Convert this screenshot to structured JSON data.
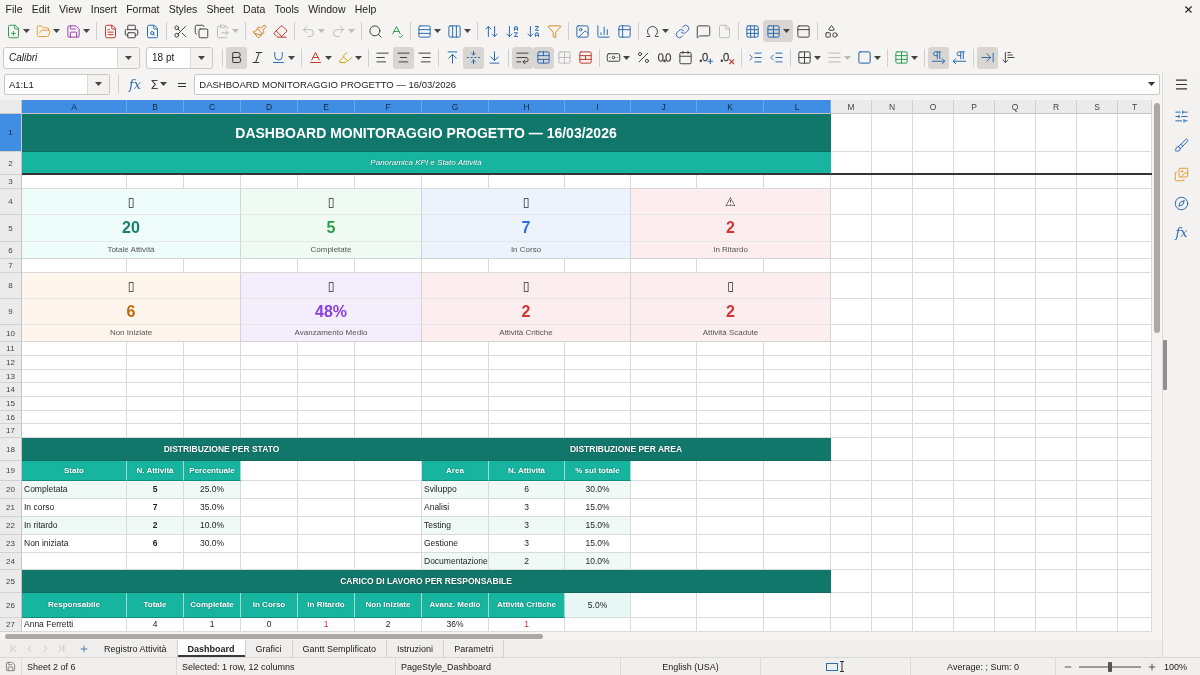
{
  "menu_bar": {
    "items": [
      "File",
      "Edit",
      "View",
      "Insert",
      "Format",
      "Styles",
      "Sheet",
      "Data",
      "Tools",
      "Window",
      "Help"
    ]
  },
  "standard_toolbar": {
    "buttons": [
      {
        "pressed": false,
        "disabled": false
      },
      {
        "pressed": false,
        "disabled": false
      },
      {
        "pressed": false,
        "disabled": false
      },
      {
        "pressed": false,
        "disabled": false
      },
      {
        "pressed": false,
        "disabled": false
      },
      {
        "pressed": false,
        "disabled": false
      },
      {
        "pressed": false,
        "disabled": false
      },
      {
        "pressed": false,
        "disabled": false
      },
      {
        "pressed": false,
        "disabled": true
      },
      {
        "pressed": false,
        "disabled": false
      },
      {
        "pressed": false,
        "disabled": false
      },
      {
        "pressed": false,
        "disabled": true
      },
      {
        "pressed": false,
        "disabled": true
      },
      {
        "pressed": false,
        "disabled": false
      },
      {
        "pressed": false,
        "disabled": false
      },
      {
        "pressed": false,
        "disabled": false
      },
      {
        "pressed": false,
        "disabled": false
      },
      {
        "pressed": false,
        "disabled": false
      },
      {
        "pressed": false,
        "disabled": false
      },
      {
        "pressed": false,
        "disabled": false
      },
      {
        "pressed": false,
        "disabled": false
      },
      {
        "pressed": false,
        "disabled": false
      },
      {
        "pressed": false,
        "disabled": false
      },
      {
        "pressed": false,
        "disabled": false
      },
      {
        "pressed": false,
        "disabled": false
      },
      {
        "pressed": false,
        "disabled": false
      },
      {
        "pressed": false,
        "disabled": false
      },
      {
        "pressed": false,
        "disabled": true
      },
      {
        "pressed": false,
        "disabled": false
      },
      {
        "pressed": true,
        "disabled": false
      },
      {
        "pressed": false,
        "disabled": false
      },
      {
        "pressed": false,
        "disabled": false
      }
    ]
  },
  "formatting_toolbar": {
    "font_name": "Calibri",
    "font_size": "18 pt",
    "buttons": [
      {
        "pressed": true,
        "disabled": false
      },
      {
        "pressed": false,
        "disabled": false
      },
      {
        "pressed": false,
        "disabled": false
      },
      {
        "pressed": false,
        "disabled": false
      },
      {
        "pressed": false,
        "disabled": false
      },
      {
        "pressed": false,
        "disabled": false
      },
      {
        "pressed": true,
        "disabled": false
      },
      {
        "pressed": false,
        "disabled": false
      },
      {
        "pressed": false,
        "disabled": false
      },
      {
        "pressed": true,
        "disabled": false
      },
      {
        "pressed": false,
        "disabled": false
      },
      {
        "pressed": true,
        "disabled": false
      },
      {
        "pressed": true,
        "disabled": false
      },
      {
        "pressed": false,
        "disabled": true
      },
      {
        "pressed": false,
        "disabled": false
      },
      {
        "pressed": false,
        "disabled": false
      },
      {
        "pressed": false,
        "disabled": false
      },
      {
        "pressed": false,
        "disabled": false
      },
      {
        "pressed": false,
        "disabled": false
      },
      {
        "pressed": false,
        "disabled": false
      },
      {
        "pressed": false,
        "disabled": false
      },
      {
        "pressed": false,
        "disabled": false
      },
      {
        "pressed": false,
        "disabled": false
      },
      {
        "pressed": false,
        "disabled": false
      },
      {
        "pressed": false,
        "disabled": true
      },
      {
        "pressed": false,
        "disabled": false
      },
      {
        "pressed": false,
        "disabled": false
      },
      {
        "pressed": true,
        "disabled": false
      },
      {
        "pressed": false,
        "disabled": false
      },
      {
        "pressed": true,
        "disabled": false
      },
      {
        "pressed": false,
        "disabled": false
      }
    ]
  },
  "formula_bar": {
    "name_box": "A1:L1",
    "function_wizard": "fx",
    "sum": "Σ",
    "formula": "=",
    "content": "DASHBOARD MONITORAGGIO PROGETTO — 16/03/2026"
  },
  "sheet": {
    "columns": [
      {
        "label": "A",
        "selected": true
      },
      {
        "label": "B",
        "selected": true
      },
      {
        "label": "C",
        "selected": true
      },
      {
        "label": "D",
        "selected": true
      },
      {
        "label": "E",
        "selected": true
      },
      {
        "label": "F",
        "selected": true
      },
      {
        "label": "G",
        "selected": true
      },
      {
        "label": "H",
        "selected": true
      },
      {
        "label": "I",
        "selected": true
      },
      {
        "label": "J",
        "selected": true
      },
      {
        "label": "K",
        "selected": true
      },
      {
        "label": "L",
        "selected": true
      },
      {
        "label": "M",
        "selected": false
      },
      {
        "label": "N",
        "selected": false
      },
      {
        "label": "O",
        "selected": false
      },
      {
        "label": "P",
        "selected": false
      },
      {
        "label": "Q",
        "selected": false
      },
      {
        "label": "R",
        "selected": false
      },
      {
        "label": "S",
        "selected": false
      },
      {
        "label": "T",
        "selected": false
      }
    ],
    "rows": [
      {
        "label": "1",
        "selected": true
      },
      {
        "label": "2",
        "selected": false
      },
      {
        "label": "3",
        "selected": false
      },
      {
        "label": "4",
        "selected": false
      },
      {
        "label": "5",
        "selected": false
      },
      {
        "label": "6",
        "selected": false
      },
      {
        "label": "7",
        "selected": false
      },
      {
        "label": "8",
        "selected": false
      },
      {
        "label": "9",
        "selected": false
      },
      {
        "label": "10",
        "selected": false
      },
      {
        "label": "11",
        "selected": false
      },
      {
        "label": "12",
        "selected": false
      },
      {
        "label": "13",
        "selected": false
      },
      {
        "label": "14",
        "selected": false
      },
      {
        "label": "15",
        "selected": false
      },
      {
        "label": "16",
        "selected": false
      },
      {
        "label": "17",
        "selected": false
      },
      {
        "label": "18",
        "selected": false
      },
      {
        "label": "19",
        "selected": false
      },
      {
        "label": "20",
        "selected": false
      },
      {
        "label": "21",
        "selected": false
      },
      {
        "label": "22",
        "selected": false
      },
      {
        "label": "23",
        "selected": false
      },
      {
        "label": "24",
        "selected": false
      },
      {
        "label": "25",
        "selected": false
      },
      {
        "label": "26",
        "selected": false
      },
      {
        "label": "27",
        "selected": false
      }
    ],
    "title": "DASHBOARD MONITORAGGIO PROGETTO — 16/03/2026",
    "subtitle": "Panoramica KPI e Stato Attività",
    "kpi_cards": [
      {
        "symbol": "▯",
        "value": "20",
        "label": "Totale Attività",
        "color": "#17806e"
      },
      {
        "symbol": "▯",
        "value": "5",
        "label": "Completate",
        "color": "#2a9d4b"
      },
      {
        "symbol": "▯",
        "value": "7",
        "label": "In Corso",
        "color": "#2f6fdf"
      },
      {
        "symbol": "⚠",
        "value": "2",
        "label": "In Ritardo",
        "color": "#d63434"
      },
      {
        "symbol": "▯",
        "value": "6",
        "label": "Non Iniziate",
        "color": "#c2680c"
      },
      {
        "symbol": "▯",
        "value": "48%",
        "label": "Avanzamento Medio",
        "color": "#8a3fe0"
      },
      {
        "symbol": "▯",
        "value": "2",
        "label": "Attività Critiche",
        "color": "#d63434"
      },
      {
        "symbol": "▯",
        "value": "2",
        "label": "Attività Scadute",
        "color": "#d63434"
      }
    ],
    "status_distribution": {
      "title": "DISTRIBUZIONE PER STATO",
      "columns": [
        "Stato",
        "N. Attività",
        "Percentuale"
      ],
      "rows": [
        [
          "Completata",
          "5",
          "25.0%"
        ],
        [
          "In corso",
          "7",
          "35.0%"
        ],
        [
          "In ritardo",
          "2",
          "10.0%"
        ],
        [
          "Non iniziata",
          "6",
          "30.0%"
        ]
      ]
    },
    "area_distribution": {
      "title": "DISTRIBUZIONE PER AREA",
      "columns": [
        "Area",
        "N. Attività",
        "% sul totale"
      ],
      "rows": [
        [
          "Sviluppo",
          "6",
          "30.0%"
        ],
        [
          "Analisi",
          "3",
          "15.0%"
        ],
        [
          "Testing",
          "3",
          "15.0%"
        ],
        [
          "Gestione",
          "3",
          "15.0%"
        ],
        [
          "Documentazione",
          "2",
          "10.0%"
        ]
      ]
    },
    "workload": {
      "title": "CARICO DI LAVORO PER RESPONSABILE",
      "columns": [
        "Responsabile",
        "Totale",
        "Completate",
        "In Corso",
        "In Ritardo",
        "Non Iniziate",
        "Avanz. Medio",
        "Attività Critiche"
      ],
      "extra_header": "5.0%",
      "rows": [
        {
          "cells": [
            {
              "text": "Anna Ferretti",
              "alert": false
            },
            {
              "text": "4",
              "alert": false
            },
            {
              "text": "1",
              "alert": false
            },
            {
              "text": "0",
              "alert": false
            },
            {
              "text": "1",
              "alert": true
            },
            {
              "text": "2",
              "alert": false
            },
            {
              "text": "36%",
              "alert": false
            },
            {
              "text": "1",
              "alert": true
            }
          ]
        }
      ]
    }
  },
  "sidebar": {
    "functions": "fx"
  },
  "sheet_tabs": {
    "navigation": [
      {
        "disabled": true
      },
      {
        "disabled": true
      },
      {
        "disabled": true
      },
      {
        "disabled": true
      }
    ],
    "tabs": [
      {
        "label": "Registro Attività",
        "selected": false
      },
      {
        "label": "Dashboard",
        "selected": true
      },
      {
        "label": "Grafici",
        "selected": false
      },
      {
        "label": "Gantt Semplificato",
        "selected": false
      },
      {
        "label": "Istruzioni",
        "selected": false
      },
      {
        "label": "Parametri",
        "selected": false
      }
    ]
  },
  "status_bar": {
    "sheet": "Sheet 2 of 6",
    "selection": "Selected: 1 row, 12 columns",
    "page_style": "PageStyle_Dashboard",
    "language": "English (USA)",
    "sum": "Average: ; Sum: 0",
    "zoom_slider": {
      "level": 0.5
    },
    "zoom": "100%"
  }
}
